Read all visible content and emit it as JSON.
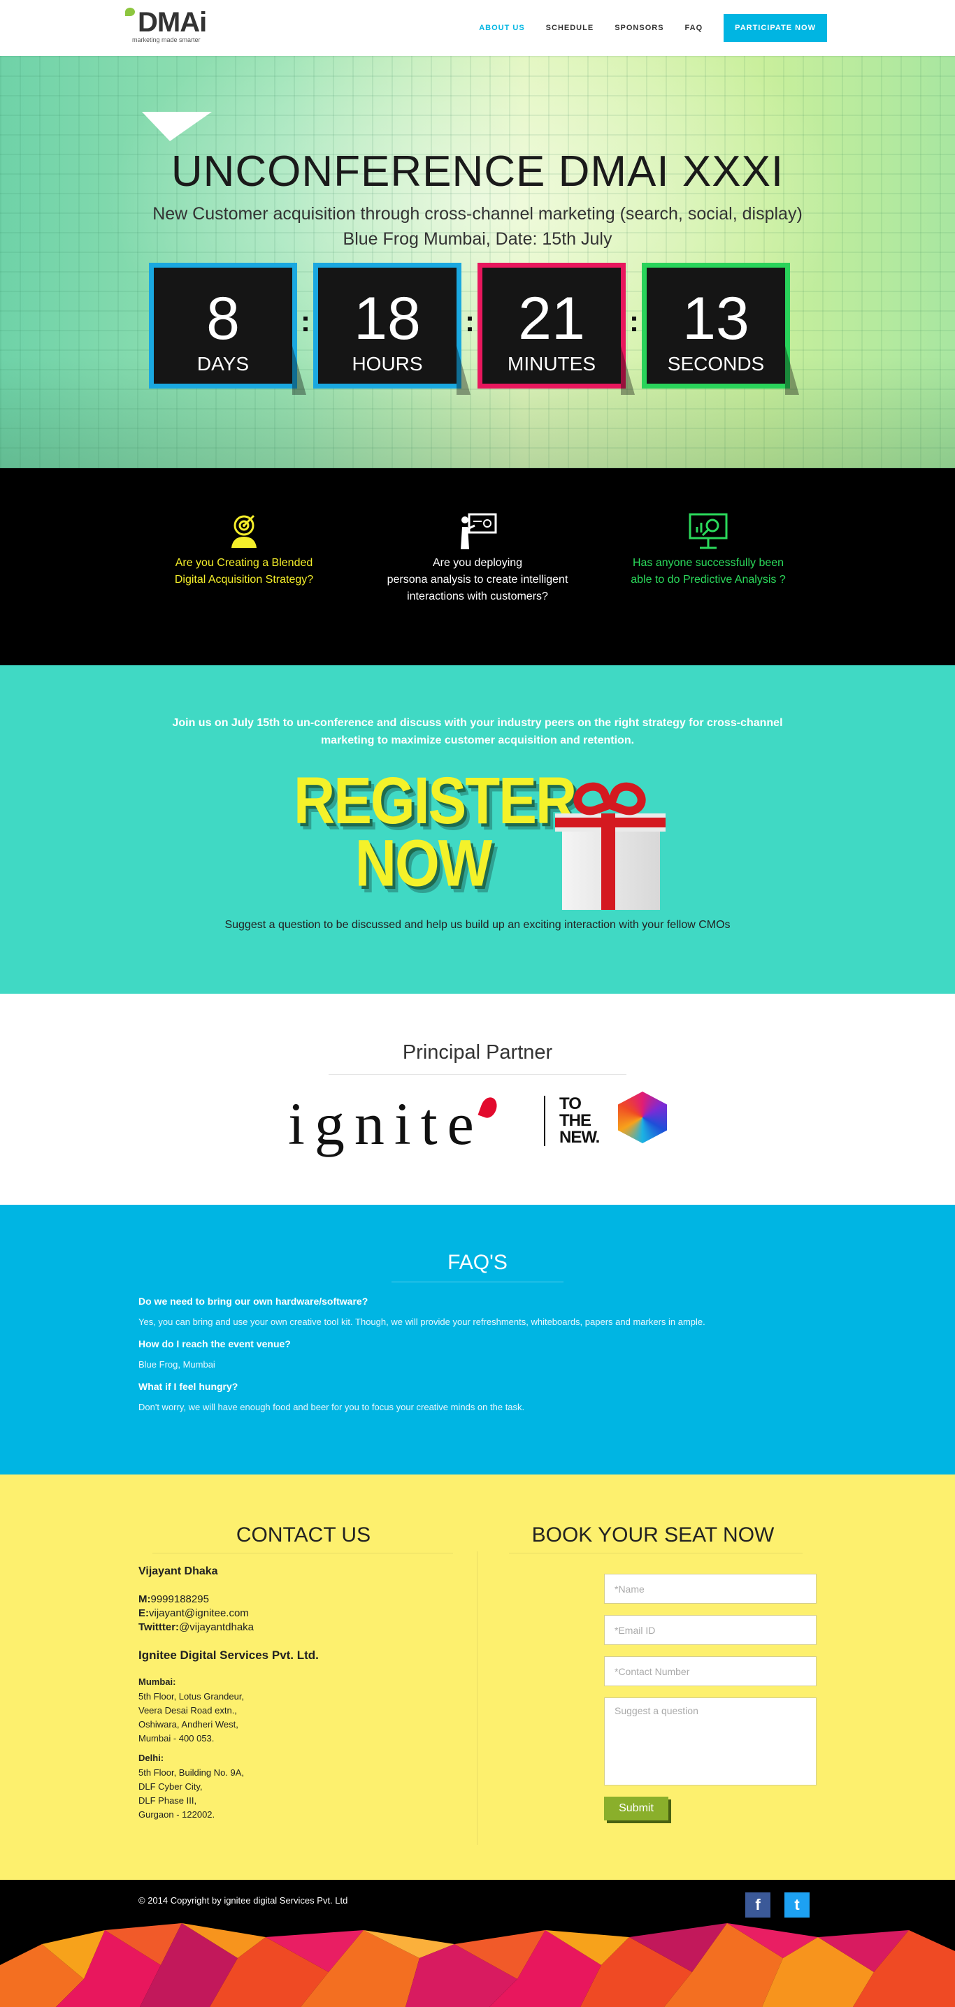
{
  "brand": {
    "name": "DMAi",
    "tagline": "marketing made smarter"
  },
  "nav": {
    "items": [
      "ABOUT US",
      "SCHEDULE",
      "SPONSORS",
      "FAQ"
    ],
    "cta": "PARTICIPATE NOW"
  },
  "hero": {
    "title": "UNCONFERENCE DMAI XXXI",
    "subtitle": "New Customer acquisition through cross-channel marketing (search, social, display)",
    "venue": "Blue Frog Mumbai, Date: 15th July"
  },
  "countdown": [
    {
      "value": "8",
      "label": "DAYS",
      "color": "#1aa8e0"
    },
    {
      "value": "18",
      "label": "HOURS",
      "color": "#1aa8e0"
    },
    {
      "value": "21",
      "label": "MINUTES",
      "color": "#e8175d"
    },
    {
      "value": "13",
      "label": "SECONDS",
      "color": "#29d35a"
    }
  ],
  "features": [
    {
      "icon": "target-icon",
      "line1": "Are you Creating a Blended",
      "line2": "Digital Acquisition Strategy?",
      "line3": "",
      "color": "#f4ee2a"
    },
    {
      "icon": "presentation-icon",
      "line1": "Are you deploying",
      "line2": "persona analysis to create intelligent",
      "line3": "interactions with customers?",
      "color": "#ffffff"
    },
    {
      "icon": "analytics-icon",
      "line1": "Has anyone successfully been",
      "line2": "able to do Predictive Analysis ?",
      "line3": "",
      "color": "#2bd95b"
    }
  ],
  "register": {
    "intro_line1": "Join us on July 15th to un-conference and discuss with your industry peers on the right strategy for cross-channel",
    "intro_line2": "marketing to maximize customer acquisition and retention.",
    "graphic_line1": "REGISTER",
    "graphic_line2": "NOW",
    "suggest": "Suggest a question to be discussed and help us build up an exciting interaction with your fellow CMOs"
  },
  "partner": {
    "title": "Principal Partner",
    "logo_text": "ignite",
    "logo_text2_l1": "TO",
    "logo_text2_l2": "THE",
    "logo_text2_l3": "NEW."
  },
  "faq": {
    "title": "FAQ'S",
    "items": [
      {
        "q": "Do we need to bring our own hardware/software?",
        "a": "Yes, you can bring and use your own creative tool kit. Though, we will provide your refreshments, whiteboards, papers and markers in ample."
      },
      {
        "q": "How do I reach the event venue?",
        "a": "Blue Frog, Mumbai"
      },
      {
        "q": "What if I feel hungry?",
        "a": "Don't worry, we will have enough food and beer for you to focus your creative minds on the task."
      }
    ]
  },
  "contact": {
    "title": "CONTACT US",
    "person": "Vijayant Dhaka",
    "phone_label": "M:",
    "phone": "9999188295",
    "email_label": "E:",
    "email": "vijayant@ignitee.com",
    "twitter_label": "Twittter:",
    "twitter": "@vijayantdhaka",
    "company": "Ignitee Digital Services Pvt. Ltd.",
    "offices": [
      {
        "city": "Mumbai:",
        "lines": [
          "5th Floor, Lotus Grandeur,",
          "Veera Desai Road extn.,",
          "Oshiwara, Andheri West,",
          "Mumbai - 400 053."
        ]
      },
      {
        "city": "Delhi:",
        "lines": [
          "5th Floor, Building No. 9A,",
          "DLF Cyber City,",
          "DLF Phase III,",
          "Gurgaon - 122002."
        ]
      }
    ]
  },
  "booking": {
    "title": "BOOK YOUR SEAT NOW",
    "name_placeholder": "*Name",
    "email_placeholder": "*Email ID",
    "phone_placeholder": "*Contact Number",
    "question_placeholder": "Suggest a question",
    "submit": "Submit"
  },
  "footer": {
    "copyright": "© 2014 Copyright by ignitee digital Services Pvt. Ltd",
    "social": [
      {
        "icon": "facebook-icon",
        "glyph": "f"
      },
      {
        "icon": "twitter-icon",
        "glyph": "t"
      }
    ]
  }
}
